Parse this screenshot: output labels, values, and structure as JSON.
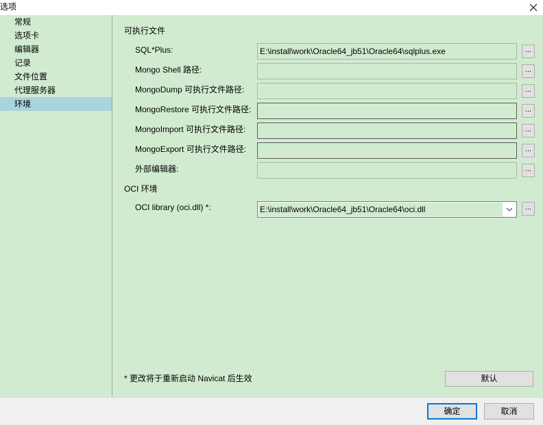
{
  "window": {
    "title": "选项",
    "close_glyph": "✕"
  },
  "sidebar": {
    "items": [
      {
        "label": "常规"
      },
      {
        "label": "选项卡"
      },
      {
        "label": "编辑器"
      },
      {
        "label": "记录"
      },
      {
        "label": "文件位置"
      },
      {
        "label": "代理服务器"
      },
      {
        "label": "环境"
      }
    ],
    "selected_index": 6
  },
  "executables": {
    "section_title": "可执行文件",
    "fields": [
      {
        "label": "SQL*Plus:",
        "value": "E:\\install\\work\\Oracle64_jb51\\Oracle64\\sqlplus.exe",
        "browse": "..."
      },
      {
        "label": "Mongo Shell 路径:",
        "value": "",
        "browse": "..."
      },
      {
        "label": "MongoDump 可执行文件路径:",
        "value": "",
        "browse": "..."
      },
      {
        "label": "MongoRestore 可执行文件路径:",
        "value": "",
        "browse": "..."
      },
      {
        "label": "MongoImport 可执行文件路径:",
        "value": "",
        "browse": "..."
      },
      {
        "label": "MongoExport 可执行文件路径:",
        "value": "",
        "browse": "..."
      },
      {
        "label": "外部编辑器:",
        "value": "",
        "browse": "..."
      }
    ]
  },
  "oci": {
    "section_title": "OCI 环境",
    "label": "OCI library (oci.dll) *:",
    "value": "E:\\install\\work\\Oracle64_jb51\\Oracle64\\oci.dll",
    "browse": "..."
  },
  "note": "* 更改将于重新启动 Navicat 后生效",
  "default_button": "默认",
  "footer": {
    "ok": "确定",
    "cancel": "取消"
  },
  "colors": {
    "panel_background": "#d1ebd1",
    "selected_item": "#a9d3dd",
    "default_button_border": "#0078d7"
  },
  "icons": {
    "close": "close-icon",
    "dropdown": "chevron-down-icon"
  }
}
